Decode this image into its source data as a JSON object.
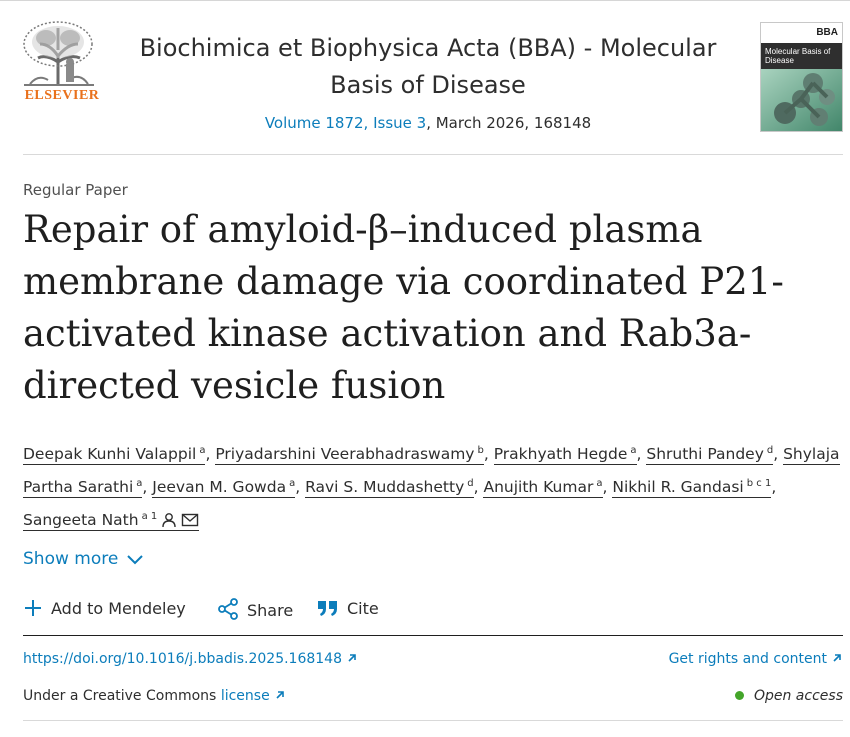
{
  "colors": {
    "link": "#0c7dbb",
    "publisher": "#e9711c",
    "open_access": "#44a52a"
  },
  "header": {
    "publisher": "ELSEVIER",
    "journal_title": "Biochimica et Biophysica Acta (BBA) - Molecular Basis of Disease",
    "volume_issue": "Volume 1872, Issue 3",
    "date_id": ", March 2026, 168148",
    "cover_badge": "BBA",
    "cover_subtitle": "Molecular Basis of Disease"
  },
  "article": {
    "type": "Regular Paper",
    "title": "Repair of amyloid-β–induced plasma membrane damage via coordinated P21-activated kinase activation and Rab3a-directed vesicle fusion"
  },
  "authors": [
    {
      "name": "Deepak Kunhi Valappil",
      "aff": "a"
    },
    {
      "name": "Priyadarshini Veerabhadraswamy",
      "aff": "b"
    },
    {
      "name": "Prakhyath Hegde",
      "aff": "a"
    },
    {
      "name": "Shruthi Pandey",
      "aff": "d"
    },
    {
      "name": "Shylaja Partha Sarathi",
      "aff": "a"
    },
    {
      "name": "Jeevan M. Gowda",
      "aff": "a"
    },
    {
      "name": "Ravi S. Muddashetty",
      "aff": "d"
    },
    {
      "name": "Anujith Kumar",
      "aff": "a"
    },
    {
      "name": "Nikhil R. Gandasi",
      "aff": "b c 1"
    },
    {
      "name": "Sangeeta Nath",
      "aff": "a 1"
    }
  ],
  "show_more": "Show more",
  "actions": {
    "mendeley": "Add to Mendeley",
    "share": "Share",
    "cite": "Cite"
  },
  "links": {
    "doi": "https://doi.org/10.1016/j.bbadis.2025.168148",
    "rights": "Get rights and content",
    "license_prefix": "Under a Creative Commons ",
    "license_link": "license",
    "open_access": "Open access"
  }
}
